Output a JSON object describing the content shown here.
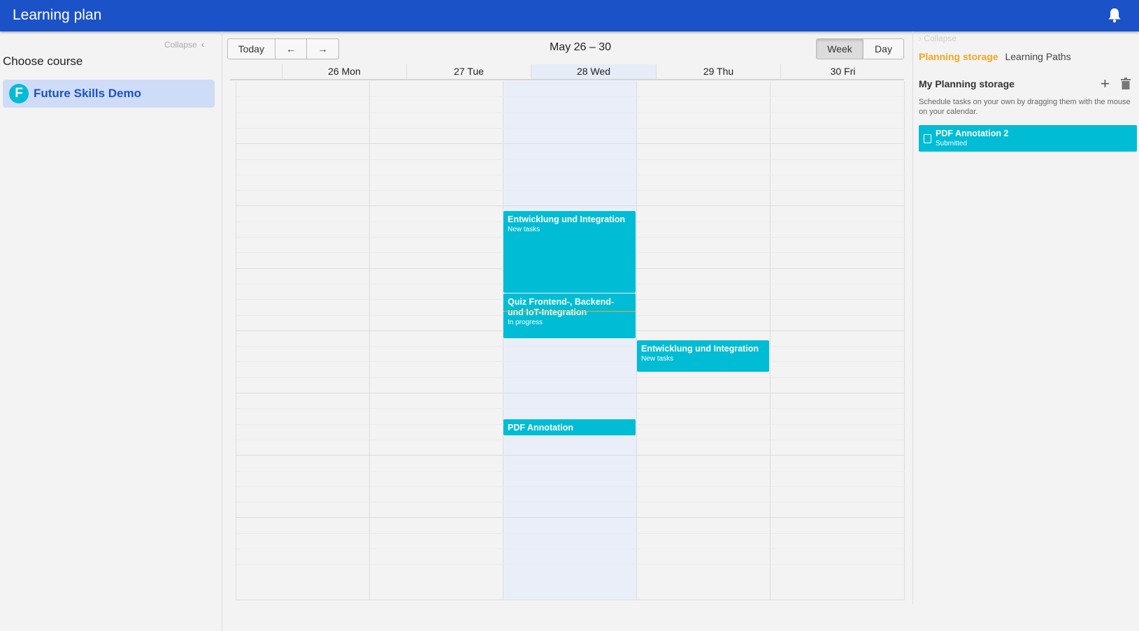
{
  "app": {
    "title": "Learning plan"
  },
  "sidebar": {
    "collapse_label": "Collapse",
    "choose_label": "Choose course",
    "courses": [
      {
        "initial": "F",
        "name": "Future Skills Demo"
      }
    ]
  },
  "toolbar": {
    "today_label": "Today",
    "prev_label": "←",
    "next_label": "→",
    "range_label": "May 26 – 30",
    "week_label": "Week",
    "day_label": "Day",
    "active_view": "Week"
  },
  "calendar": {
    "days": [
      "26 Mon",
      "27 Tue",
      "28 Wed",
      "29 Thu",
      "30 Fri"
    ],
    "today_index": 2,
    "events": [
      {
        "title": "Entwicklung und Integration",
        "status": "New tasks",
        "day": "28 Wed"
      },
      {
        "title": "Quiz Frontend-, Backend- und IoT-Integration",
        "status": "In progress",
        "day": "28 Wed"
      },
      {
        "title": "Entwicklung und Integration",
        "status": "New tasks",
        "day": "29 Thu"
      },
      {
        "title": "PDF Annotation",
        "status": "",
        "day": "28 Wed"
      }
    ]
  },
  "right_panel": {
    "collapse_label": "Collapse",
    "tabs": [
      "Planning storage",
      "Learning Paths"
    ],
    "active_tab": "Planning storage",
    "storage_title": "My Planning storage",
    "hint": "Schedule tasks on your own by dragging them with the mouse on your calendar.",
    "items": [
      {
        "title": "PDF Annotation 2",
        "status": "Submitted"
      }
    ]
  },
  "colors": {
    "header": "#1c52c8",
    "event": "#00bcd4",
    "active_tab": "#f5a623",
    "today_column": "#e9eef8",
    "course_highlight": "#cfdcf7"
  },
  "icons": [
    "bell-icon",
    "chevron-left-icon",
    "chevron-right-icon",
    "plus-icon",
    "trash-icon",
    "clipboard-icon"
  ]
}
